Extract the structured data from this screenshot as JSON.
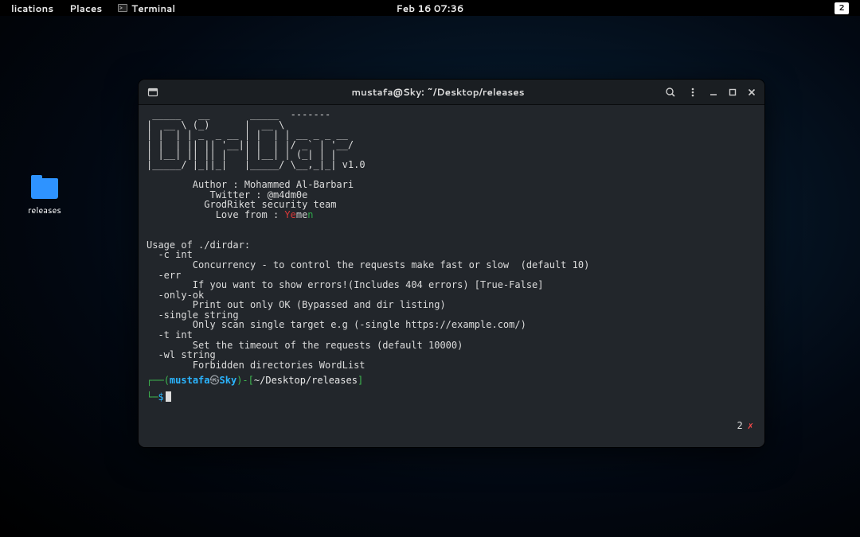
{
  "topbar": {
    "applications": "lications",
    "places": "Places",
    "terminal": "Terminal",
    "datetime": "Feb 16  07:36",
    "workspace": "2"
  },
  "desktop": {
    "folder_label": "releases"
  },
  "window": {
    "title": "mustafa@Sky: ~/Desktop/releases"
  },
  "term": {
    "ascii": " _____   __       _____  -------\n|  __ \\ (_)      |  __ \\         \n| |  | | _  _ __ | |  | | __ _ _ __\n| |  | || || '__|| |  | |/ _` | '__/\n| |__| || || |   | |__| | (_| | |\n|_____/ |_||_|   |_____/ \\__,_|_|",
    "version": "v1.0",
    "author_line": "        Author : Mohammed Al-Barbari",
    "twitter_line": "           Twitter : @m4dm0e",
    "team_line": "          GrodRiket security team",
    "love_prefix": "            Love from : ",
    "yem": {
      "y": "Ye",
      "m": "me",
      "n": "n"
    },
    "usage_header": "Usage of ./dirdar:",
    "flags": [
      {
        "flag": "  -c int",
        "desc": "        Concurrency - to control the requests make fast or slow  (default 10)"
      },
      {
        "flag": "  -err",
        "desc": "        If you want to show errors!(Includes 404 errors) [True-False]"
      },
      {
        "flag": "  -only-ok",
        "desc": "        Print out only OK (Bypassed and dir listing)"
      },
      {
        "flag": "  -single string",
        "desc": "        Only scan single target e.g (-single https://example.com/)"
      },
      {
        "flag": "  -t int",
        "desc": "        Set the timeout of the requests (default 10000)"
      },
      {
        "flag": "  -wl string",
        "desc": "        Forbidden directories WordList"
      }
    ],
    "prompt": {
      "lp": "(",
      "user": "mustafa",
      "at": "㉿",
      "host": "Sky",
      "rp": ")-[",
      "path": "~/Desktop/releases",
      "rb": "]",
      "dollar": "$"
    },
    "err_count": "2",
    "err_x": "✗"
  }
}
